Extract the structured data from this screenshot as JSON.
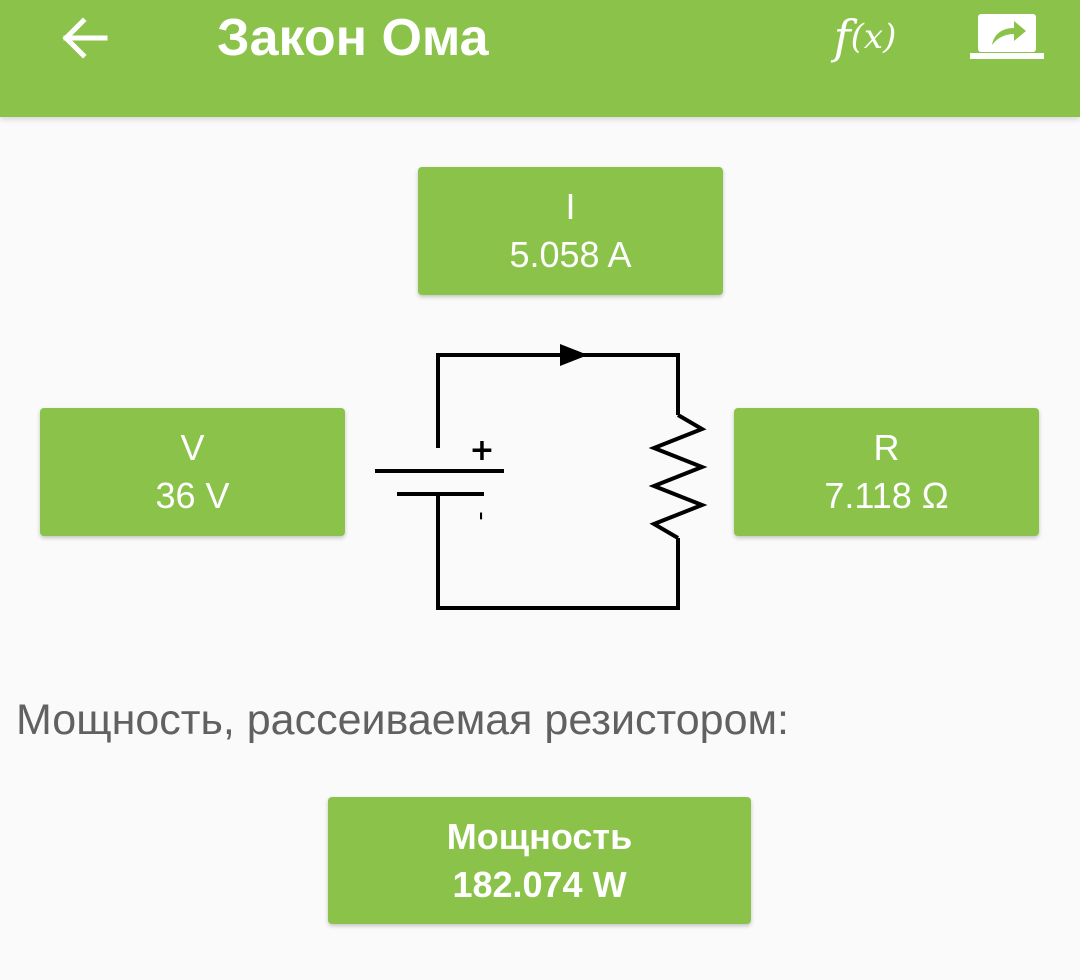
{
  "header": {
    "title": "Закон Ома",
    "fx_f": "f",
    "fx_x": "(x)",
    "back_icon": "arrow-left-icon",
    "share_icon": "share-screen-icon",
    "color": "#8bc34a"
  },
  "current": {
    "label": "I",
    "value": "5.058 A"
  },
  "voltage": {
    "label": "V",
    "value": "36 V"
  },
  "resistance": {
    "label": "R",
    "value": "7.118 Ω"
  },
  "circuit": {
    "plus": "+",
    "minus": "-"
  },
  "power_caption": "Мощность, рассеиваемая резистором:",
  "power": {
    "label": "Мощность",
    "value": "182.074 W"
  }
}
